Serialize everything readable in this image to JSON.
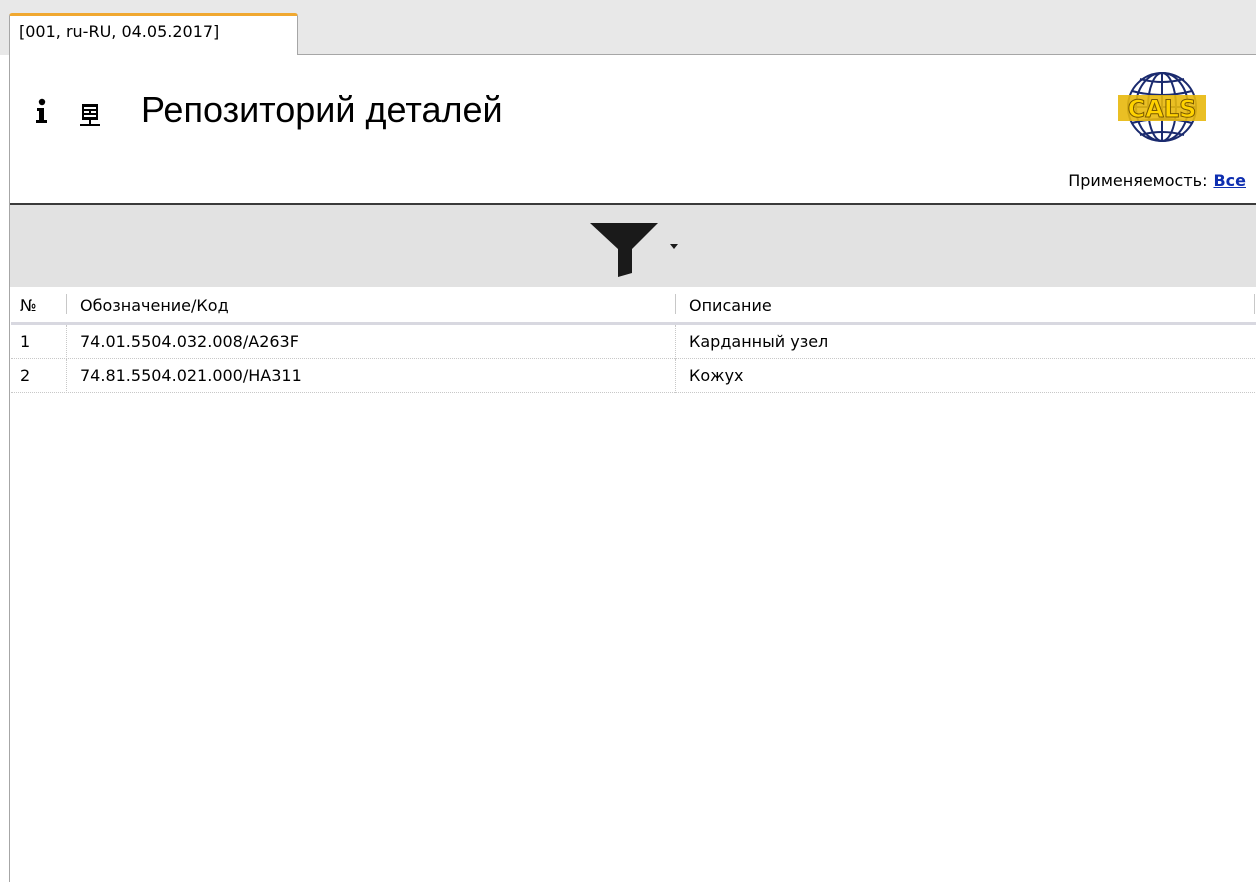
{
  "tab": {
    "label": "[001, ru-RU, 04.05.2017]"
  },
  "header": {
    "title": "Репозиторий деталей",
    "logo_text": "CALS",
    "applicability_label": "Применяемость:",
    "applicability_value": "Все"
  },
  "toolbar": {
    "filter_icon": "filter-icon",
    "dropdown_icon": "chevron-down-icon"
  },
  "grid": {
    "columns": [
      "№",
      "Обозначение/Код",
      "Описание"
    ],
    "rows": [
      {
        "num": "1",
        "code": "74.01.5504.032.008/A263F",
        "description": "Карданный узел"
      },
      {
        "num": "2",
        "code": "74.81.5504.021.000/HA311",
        "description": "Кожух"
      }
    ]
  },
  "colors": {
    "tab_accent": "#f0a830",
    "link": "#0f2fb0",
    "filter_bar_bg": "#e2e2e2"
  }
}
